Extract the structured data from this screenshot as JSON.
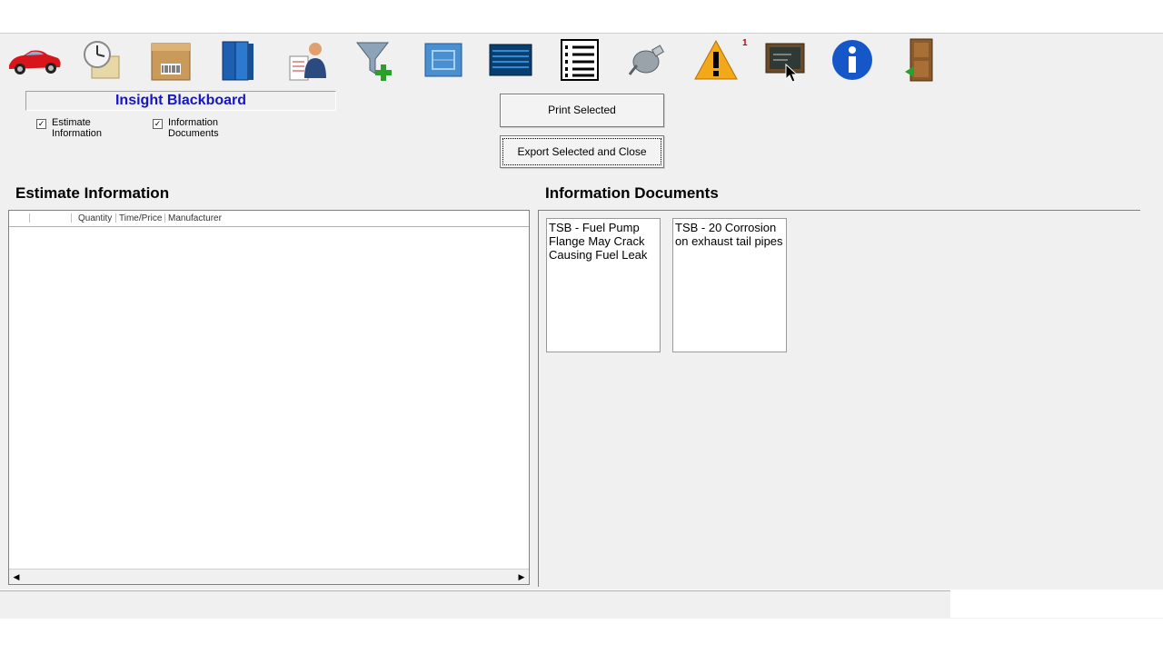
{
  "toolbar": {
    "icons": [
      {
        "name": "car-icon"
      },
      {
        "name": "clock-icon"
      },
      {
        "name": "parts-box-icon"
      },
      {
        "name": "manuals-book-icon"
      },
      {
        "name": "customer-icon"
      },
      {
        "name": "filter-add-icon"
      },
      {
        "name": "diagram-icon"
      },
      {
        "name": "panel-icon"
      },
      {
        "name": "numbered-list-icon"
      },
      {
        "name": "plug-icon"
      },
      {
        "name": "warning-icon"
      },
      {
        "name": "blackboard-icon"
      },
      {
        "name": "info-icon"
      },
      {
        "name": "exit-door-icon"
      }
    ],
    "warning_badge": "1"
  },
  "blackboard": {
    "title": "Insight Blackboard",
    "filters": [
      {
        "label_line1": "Estimate",
        "label_line2": "Information",
        "checked": true,
        "check_glyph": "✓"
      },
      {
        "label_line1": "Information",
        "label_line2": "Documents",
        "checked": true,
        "check_glyph": "✓"
      }
    ]
  },
  "actions": {
    "print_label": "Print Selected",
    "export_label": "Export Selected and Close"
  },
  "estimate": {
    "title": "Estimate Information",
    "columns": [
      "Quantity",
      "Time/Price",
      "Manufacturer"
    ],
    "rows": [],
    "scroll_left": "◀",
    "scroll_right": "▶"
  },
  "documents": {
    "title": "Information Documents",
    "items": [
      {
        "text": "TSB - Fuel Pump Flange May Crack Causing Fuel Leak"
      },
      {
        "text": "TSB - 20 Corrosion on exhaust tail pipes"
      }
    ]
  },
  "colors": {
    "title_blue": "#1515c8",
    "badge_red": "#c00000",
    "window_bg": "#f0f0f0"
  }
}
